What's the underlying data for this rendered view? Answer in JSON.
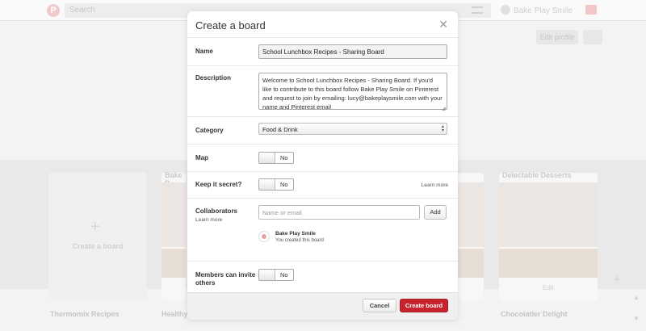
{
  "background": {
    "search_placeholder": "Search",
    "user_name": "Bake Play Smile",
    "edit_profile_label": "Edit profile",
    "create_board_label": "Create a board",
    "board_titles_row1": [
      "Bake P",
      "Delectable Desserts"
    ],
    "board_titles_row2": [
      "Thermomix Recipes",
      "Healthy",
      "Chocolatier Delight"
    ],
    "edit_label": "Edit"
  },
  "modal": {
    "title": "Create a board",
    "close_icon": "close-icon",
    "name": {
      "label": "Name",
      "value": "School Lunchbox Recipes - Sharing Board"
    },
    "description": {
      "label": "Description",
      "value": "Welcome to School Lunchbox Recipes - Sharing Board. If you'd like to contribute to this board follow Bake Play Smile on Pinterest and request to join by emailing: lucy@bakeplaysmile.com with your name and Pinterest email"
    },
    "category": {
      "label": "Category",
      "selected": "Food & Drink"
    },
    "map": {
      "label": "Map",
      "toggle_value": "No"
    },
    "secret": {
      "label": "Keep it secret?",
      "toggle_value": "No",
      "learn_more": "Learn more"
    },
    "collaborators": {
      "label": "Collaborators",
      "learn_more": "Learn more",
      "input_placeholder": "Name or email",
      "add_label": "Add",
      "owner_name": "Bake Play Smile",
      "owner_sub": "You created this board"
    },
    "members_invite": {
      "label": "Members can invite others",
      "toggle_value": "No"
    },
    "footer": {
      "cancel_label": "Cancel",
      "create_label": "Create board"
    }
  },
  "colors": {
    "accent": "#c8232c",
    "overlay": "#f3f3f3"
  }
}
